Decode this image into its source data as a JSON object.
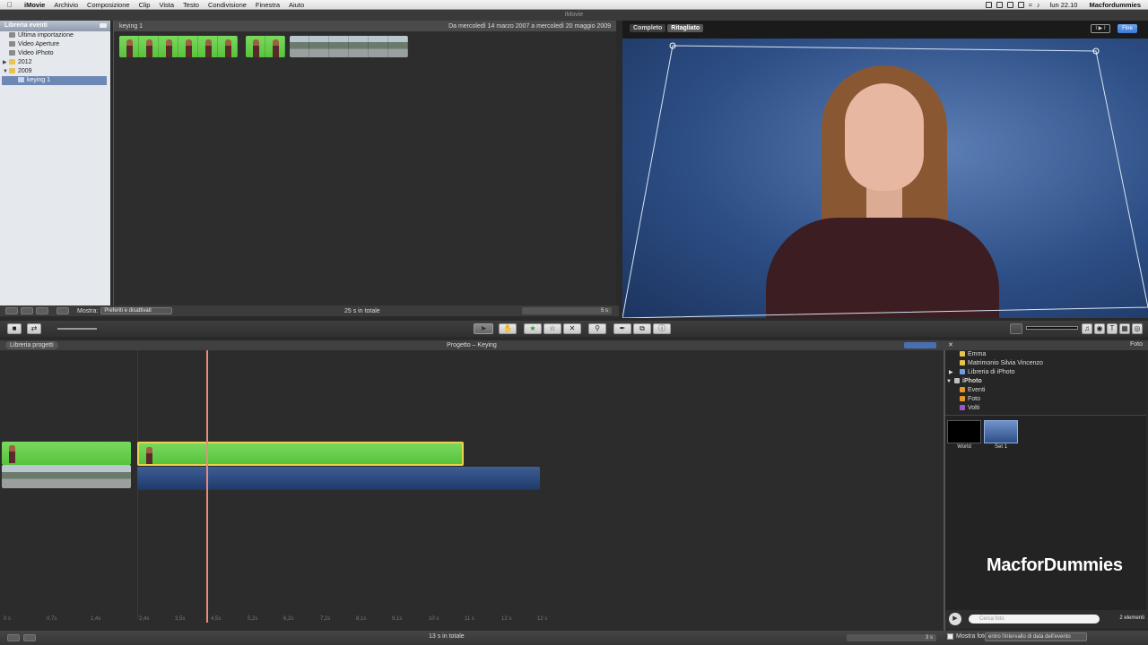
{
  "menubar": {
    "app": "iMovie",
    "menus": [
      "Archivio",
      "Composizione",
      "Clip",
      "Vista",
      "Testo",
      "Condivisione",
      "Finestra",
      "Aiuto"
    ],
    "clock": "lun 22.10",
    "user": "Macfordummies"
  },
  "window": {
    "title": "iMovie"
  },
  "event_library": {
    "header": "Libreria eventi",
    "items": [
      {
        "label": "Ultima importazione"
      },
      {
        "label": "Video Aperture"
      },
      {
        "label": "Video iPhoto"
      },
      {
        "label": "2012"
      },
      {
        "label": "2009"
      },
      {
        "label": "keying 1"
      }
    ]
  },
  "event_browser": {
    "title": "keying 1",
    "date_range": "Da mercoledì 14 marzo 2007 a mercoledì 20 maggio 2009"
  },
  "event_toolbar": {
    "mostra_label": "Mostra:",
    "filter_value": "Preferiti e disattivati",
    "total": "25 s in totale",
    "zoom": "5 s"
  },
  "viewer": {
    "tabs": [
      "Completo",
      "Ritagliato"
    ],
    "done_label": "Fine",
    "play_label": "I ▶ I"
  },
  "project": {
    "library_button": "Libreria progetti",
    "title": "Progetto – Keying",
    "ruler": [
      "0 s",
      "0,7s",
      "1,4s",
      "2,4s",
      "3,5s",
      "4,5s",
      "5,2s",
      "6,2s",
      "7,2s",
      "8,1s",
      "9,1s",
      "10 s",
      "11 s",
      "12 s",
      "12 s"
    ]
  },
  "footer": {
    "total": "13 s in totale",
    "zoom": "3 s",
    "mostra_foto": "Mostra foto",
    "range_dropdown": "entro l'intervallo di data dell'evento"
  },
  "photo_browser": {
    "header_label": "Foto",
    "tree": [
      {
        "label": "Emma"
      },
      {
        "label": "Matrimonio Silvia Vincenzo"
      },
      {
        "label": "Libreria di iPhoto"
      },
      {
        "label": "iPhoto"
      },
      {
        "label": "Eventi"
      },
      {
        "label": "Foto"
      },
      {
        "label": "Volti"
      }
    ],
    "thumbs": [
      {
        "label": "World"
      },
      {
        "label": "Set 1"
      }
    ],
    "search_placeholder": "Cerca foto",
    "count": "2 elementi"
  },
  "watermark": "MacforDummies"
}
